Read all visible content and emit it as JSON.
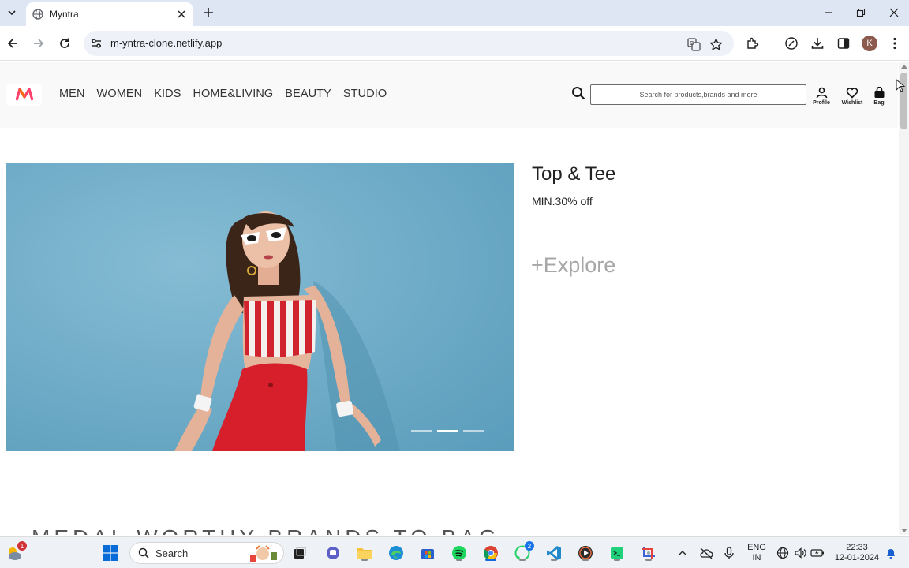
{
  "browser": {
    "tab": {
      "title": "Myntra"
    },
    "address": {
      "url": "m-yntra-clone.netlify.app"
    },
    "profile_initial": "K"
  },
  "site": {
    "nav": [
      "MEN",
      "WOMEN",
      "KIDS",
      "HOME&LIVING",
      "BEAUTY",
      "STUDIO"
    ],
    "search": {
      "placeholder": "Search for products,brands and more"
    },
    "actions": {
      "profile": "Profile",
      "wishlist": "Wishlist",
      "bag": "Bag"
    },
    "promo": {
      "title": "Top & Tee",
      "subtitle": "MIN.30% off",
      "cta": "+Explore"
    },
    "carousel": {
      "slide_count": 3,
      "active_index": 1
    },
    "section_title": "MEDAL WORTHY BRANDS TO BAG"
  },
  "taskbar": {
    "search_label": "Search",
    "widgets_badge": "1",
    "whatsapp_badge": "2",
    "language_line1": "ENG",
    "language_line2": "IN",
    "time": "22:33",
    "date": "12-01-2024"
  },
  "colors": {
    "brand_pink": "#ff3f6c",
    "brand_orange": "#f26a10",
    "hero_bg": "#6aaac6"
  }
}
